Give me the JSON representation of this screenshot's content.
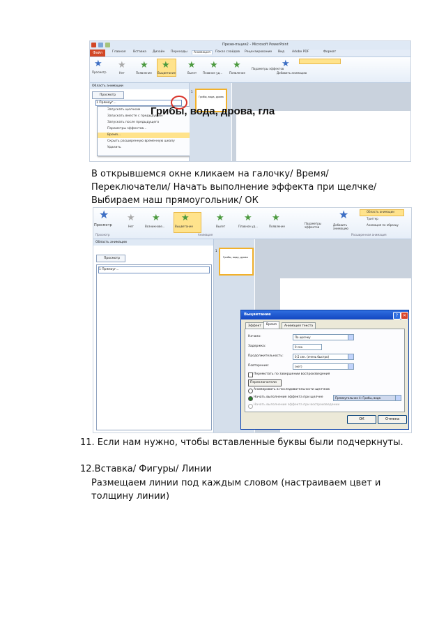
{
  "screenshot1": {
    "window_title": "Презентация2 - Microsoft PowerPoint",
    "file_tab": "Файл",
    "ribbon_tabs": [
      "Главная",
      "Вставка",
      "Дизайн",
      "Переходы",
      "Анимация",
      "Показ слайдов",
      "Рецензирование",
      "Вид",
      "Adobe PDF",
      "Формат"
    ],
    "ribbon_buttons": [
      "Просмотр",
      "Нет",
      "Появление",
      "Выцветание",
      "Вылет",
      "Плавное уд...",
      "Появление",
      "Параметры эффектов",
      "Добавить анимацию"
    ],
    "pane_title": "Область анимации",
    "play_button": "Просмотр",
    "list_row": "1 Прямоуг...",
    "menu_items": [
      "Запускать щелчком",
      "Запускать вместе с предыдущим",
      "Запускать после предыдущего",
      "Параметры эффектов...",
      "Время...",
      "Скрыть расширенную временную шкалу",
      "Удалить"
    ],
    "slide_thumb_number": "1",
    "slide_thumb_text": "Грибы, вода, дрова",
    "slide_title": "Грибы, вода, дрова, гла"
  },
  "instruction1": "В открывшемся окне кликаем на галочку/ Время/ Переключатели/ Начать выполнение эффекта при щелчке/ Выбираем наш прямоугольник/ ОК",
  "screenshot2": {
    "ribbon_buttons": [
      "Просмотр",
      "Нет",
      "Возникнове...",
      "Выцветание",
      "Вылет",
      "Плавное уд...",
      "Появление",
      "Параметры эффектов",
      "Добавить анимацию"
    ],
    "ribbon_side": [
      "Область анимации",
      "Триггер",
      "Анимация по образцу"
    ],
    "group_labels": [
      "Просмотр",
      "Анимация",
      "Расширенная анимация"
    ],
    "pane_title": "Область анимации",
    "play_button": "Просмотр",
    "list_row": "1 Прямоуг...",
    "dialog": {
      "title": "Выцветание",
      "tabs": [
        "Эффект",
        "Время",
        "Анимация текста"
      ],
      "rows": [
        {
          "label": "Начало:",
          "value": "По щелчку"
        },
        {
          "label": "Задержка:",
          "value": "0 сек."
        },
        {
          "label": "Продолжительность:",
          "value": "0,5 сек. (очень быстро)"
        },
        {
          "label": "Повторение:",
          "value": "(нет)"
        }
      ],
      "rewind_label": "Перемотать по завершении воспроизведения",
      "triggers_button": "Переключатели",
      "radio_options": [
        "Анимировать в последовательности щелчков",
        "Начать выполнение эффекта при щелчке",
        "Начать выполнение эффекта при воспроизведении"
      ],
      "trigger_value": "Прямоугольник 4: Грибы, вода",
      "ok": "ОК",
      "cancel": "Отмена"
    }
  },
  "item11": "11. Если нам нужно, чтобы вставленные буквы были подчеркнуты.",
  "item12": "12.Вставка/ Фигуры/ Линии",
  "item12_detail": "Размещаем линии под каждым словом (настраиваем цвет и толщину линии)"
}
